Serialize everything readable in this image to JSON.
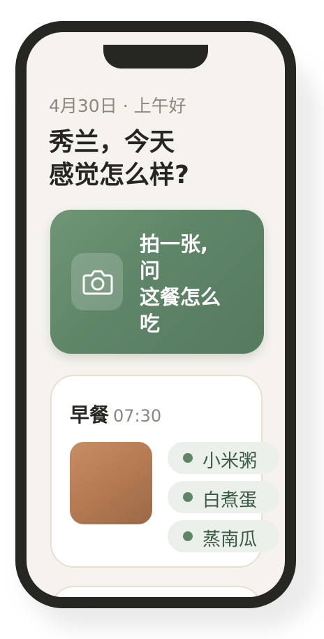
{
  "header": {
    "date": "4月30日",
    "separator": "·",
    "greeting": "上午好",
    "title_line1": "秀兰，今天",
    "title_line2": "感觉怎么样?"
  },
  "camera_card": {
    "icon": "camera-icon",
    "line1": "拍一张,",
    "line2": "问",
    "line3": "这餐怎么",
    "line4": "吃"
  },
  "meal": {
    "name": "早餐",
    "time": "07:30",
    "photo_color": "#b57a52",
    "items": [
      {
        "label": "小米粥"
      },
      {
        "label": "白煮蛋"
      },
      {
        "label": "蒸南瓜"
      }
    ]
  },
  "colors": {
    "accent": "#5f8568",
    "background": "#f6f3ee",
    "frame": "#262622"
  }
}
